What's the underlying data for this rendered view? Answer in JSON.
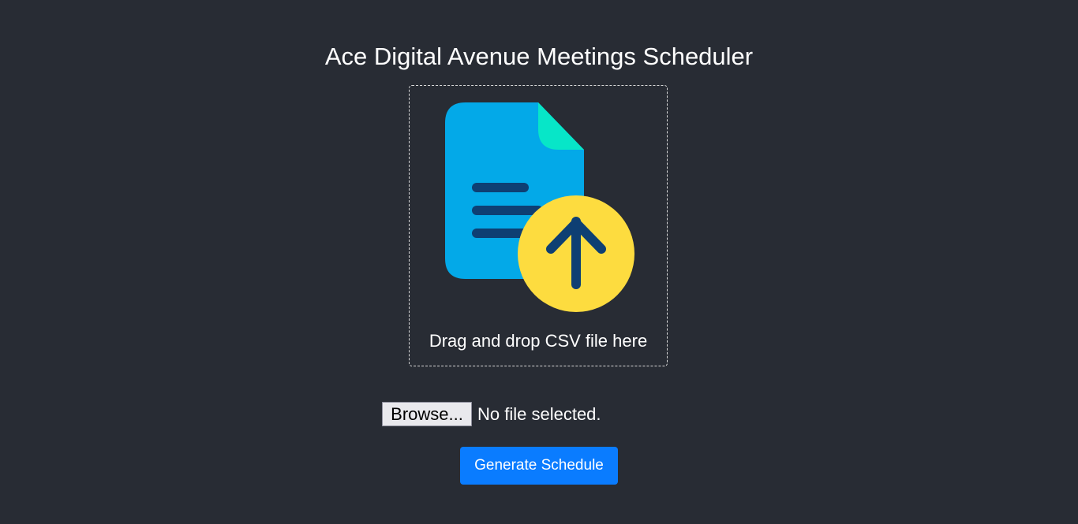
{
  "header": {
    "title": "Ace Digital Avenue Meetings Scheduler"
  },
  "dropzone": {
    "icon": "file-upload-icon",
    "instruction": "Drag and drop CSV file here"
  },
  "file_input": {
    "button_label": "Browse...",
    "status": "No file selected."
  },
  "actions": {
    "generate_label": "Generate Schedule"
  },
  "colors": {
    "background": "#282c34",
    "document": "#03a9e8",
    "document_fold": "#07e6c8",
    "upload_circle": "#fddc3f",
    "icon_strokes": "#0e3f73",
    "primary_button": "#0a7cff"
  }
}
